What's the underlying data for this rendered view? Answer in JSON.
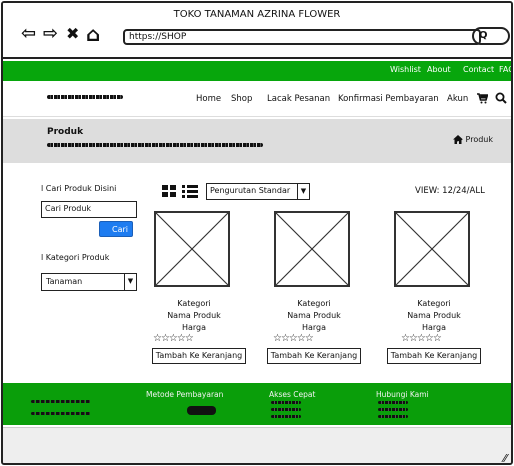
{
  "browser": {
    "title": "TOKO TANAMAN AZRINA FLOWER",
    "url": "https://SHOP",
    "search_symbol": "Q",
    "nav": {
      "back": "⇦",
      "forward": "⇨",
      "stop": "✖",
      "home": "⌂"
    }
  },
  "topbar": {
    "links": [
      "Wishlist",
      "About",
      "Contact",
      "FAQ"
    ]
  },
  "mainnav": {
    "items": [
      "Home",
      "Shop",
      "Lacak Pesanan",
      "Konfirmasi Pembayaran",
      "Akun"
    ],
    "cart_icon": "cart-icon",
    "search_icon": "search-icon"
  },
  "band": {
    "title": "Produk",
    "crumb": "> Produk"
  },
  "sidebar": {
    "search_label": "l Cari Produk Disini",
    "search_value": "Cari Produk",
    "search_button": "Cari",
    "category_label": "l Kategori Produk",
    "category_value": "Tanaman"
  },
  "toolbar": {
    "sort_value": "Pengurutan Standar",
    "view": "VIEW: 12/24/ALL"
  },
  "products": [
    {
      "kategori": "Kategori",
      "nama": "Nama Produk",
      "harga": "Harga",
      "stars": "☆☆☆☆☆",
      "cart": "Tambah Ke Keranjang",
      "rating": 0
    },
    {
      "kategori": "Kategori",
      "nama": "Nama Produk",
      "harga": "Harga",
      "stars": "☆☆☆☆☆",
      "cart": "Tambah Ke Keranjang",
      "rating": 0
    },
    {
      "kategori": "Kategori",
      "nama": "Nama Produk",
      "harga": "Harga",
      "stars": "☆☆☆☆☆",
      "cart": "Tambah Ke Keranjang",
      "rating": 0
    }
  ],
  "footer": {
    "headings": [
      "Metode Pembayaran",
      "Akses Cepat",
      "Hubungi Kami"
    ]
  },
  "colors": {
    "green": "#07a60c",
    "footer_green": "#0a9e0a",
    "button_blue": "#1e7cf0",
    "band_gray": "#dddddd"
  }
}
